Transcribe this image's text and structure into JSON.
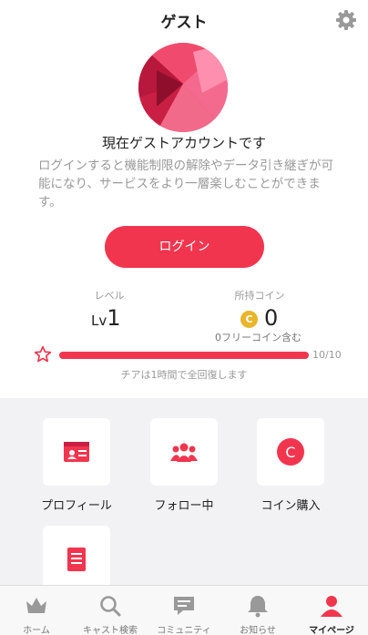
{
  "header": {
    "title": "ゲスト",
    "settings_icon": "gear-icon"
  },
  "guest": {
    "heading": "現在ゲストアカウントです",
    "description": "ログインすると機能制限の解除やデータ引き継ぎが可能になり、サービスをより一層楽しむことができます。",
    "login_label": "ログイン"
  },
  "stats": {
    "level_label": "レベル",
    "level_prefix": "Lv",
    "level_value": "1",
    "coin_label": "所持コイン",
    "coin_icon_letter": "C",
    "coin_value": "0",
    "free_coin_note": "0フリーコイン含む"
  },
  "cheer": {
    "gauge_text": "10/10",
    "fraction": 1.0,
    "note": "チアは1時間で全回復します"
  },
  "menu": {
    "items": [
      {
        "label": "プロフィール",
        "icon": "profile-card-icon"
      },
      {
        "label": "フォロー中",
        "icon": "people-icon"
      },
      {
        "label": "コイン購入",
        "icon": "coin-icon",
        "letter": "C"
      },
      {
        "label": "",
        "icon": "document-icon"
      }
    ]
  },
  "tabbar": {
    "items": [
      {
        "label": "ホーム",
        "icon": "crown-icon"
      },
      {
        "label": "キャスト検索",
        "icon": "search-icon"
      },
      {
        "label": "コミュニティ",
        "icon": "chat-icon"
      },
      {
        "label": "お知らせ",
        "icon": "bell-icon"
      },
      {
        "label": "マイページ",
        "icon": "person-icon",
        "active": true
      }
    ]
  },
  "colors": {
    "accent": "#f2354e",
    "coin": "#e9b52a",
    "gray": "#999999",
    "menu_bg": "#f2f2f4",
    "gauge_track": "#f6d7dc"
  }
}
